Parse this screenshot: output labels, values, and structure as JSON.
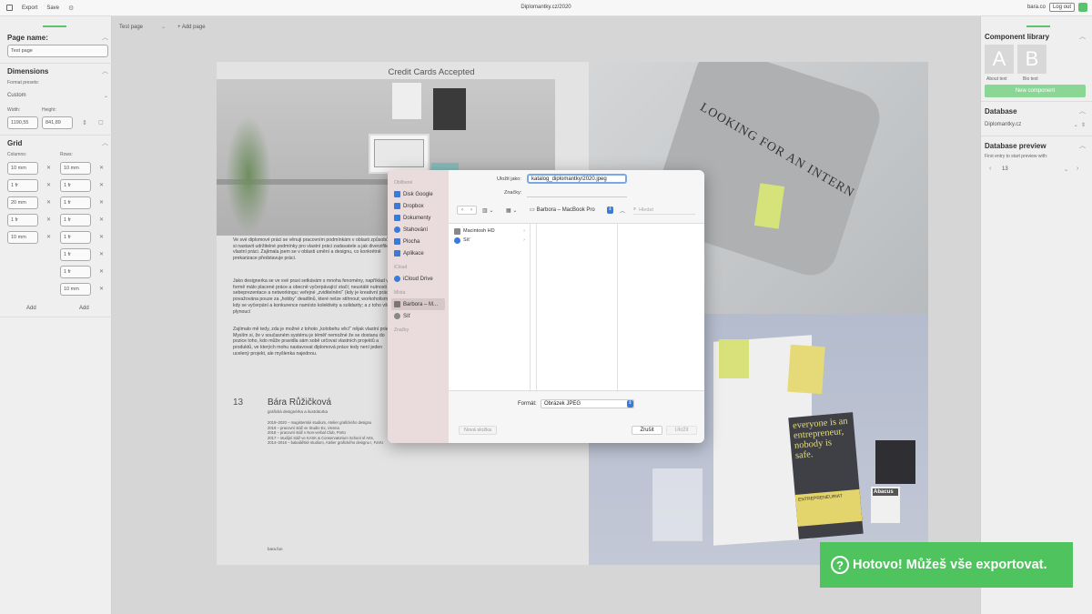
{
  "topbar": {
    "export_label": "Export",
    "save_label": "Save",
    "doc_title": "Diplomantky.cz/2020",
    "user": "bara.co",
    "logout_label": "Log out"
  },
  "left": {
    "page_name_title": "Page name:",
    "page_name_value": "Test page",
    "dimensions_title": "Dimensions",
    "format_presets_label": "Format presets:",
    "format_preset_value": "Custom",
    "width_label": "Width:",
    "height_label": "Height:",
    "width_value": "1190,55",
    "height_value": "841,89",
    "grid_title": "Grid",
    "columns_label": "Columns:",
    "rows_label": "Rows:",
    "columns": [
      "10 mm",
      "1 fr",
      "20 mm",
      "1 fr",
      "10 mm"
    ],
    "rows": [
      "10 mm",
      "1 fr",
      "1 fr",
      "1 fr",
      "1 fr",
      "1 fr",
      "1 fr",
      "10 mm"
    ],
    "add_col_label": "Add",
    "add_row_label": "Add"
  },
  "canvas": {
    "page_select": "Test page",
    "add_page_label": "Add page"
  },
  "page": {
    "photo_title": "Credit Cards Accepted",
    "para1": "Ve své diplomové práci se věnuji pracovním podmínkám v oblasti způsobů, jak si nastavit udržitelné podmínky pro vlastní práci zadavatele a jak diverzifikovat vlastní práci. Zajímala jsem se v oblasti umění a designu, co konkrétně prekarizace představuje práci.",
    "para2": "Jako designerka se ve své praxi setkávám s mnoha fenomény, například ve formě málo placené práce a obecně vyčerpávající stačí; neustálé nutnosti sebeprezentace a networkingu; veřejné „zviditelnění“ (kdy je kreativní práce považována pouze za „hobby“ deadlinů, které nelze stihnout; workoholismu, kdy se vyčerpání a konkurence namísto kolektivity a solidarity; a z toho vše plynoucí",
    "para3": "Zajímalo mě tedy, zda je možné z tohoto „kolobehu věcí“ nějak vlastní práci. Myslím si, že v současném systému je téměř nemožné že se dostanu do pozice toho, kdo může pravidla sám sobě určovat vlastních projektů a produktů, ve kterých mohu nastavovat diplomová práce tedy není jeden ucelený projekt, ale myšlenka najednou.",
    "number": "13",
    "name": "Bára Růžičková",
    "role": "grafická designérka a ilustrátorka",
    "bio": [
      "2019–2020 – magisterské studium, Atelier grafického designu",
      "2019 – pracovní stáž ve Studio Ex, Vienna",
      "2018 – pracovní stáž v Non-verbal Club, Porto",
      "2017 – studijní stáž ve KASK & Conservatorium School of Arts,",
      "2014–2018 – bakalářské studium, Atelier grafického designu I, FaVU"
    ],
    "footer": "bara.fun",
    "shirt_text": "LOOKING FOR AN INTERN",
    "book_text": "everyone is an entrepreneur, nobody is safe.",
    "book_small": "ENTREPRENEURIAT",
    "abacus": "Abacus"
  },
  "dialog": {
    "save_as_label": "Uložit jako:",
    "save_as_value": "katalog_diplomantky/2020.jpeg",
    "tags_label": "Značky:",
    "location": "Barbora – MacBook Pro",
    "search_placeholder": "Hledat",
    "sidebar": {
      "favorites_head": "Oblíbené",
      "favorites": [
        "Disk Google",
        "Dropbox",
        "Dokumenty",
        "Stahování",
        "Plocha",
        "Aplikace"
      ],
      "icloud_head": "iCloud",
      "icloud": [
        "iCloud Drive"
      ],
      "places_head": "Místa",
      "places": [
        "Barbora – M...",
        "Síť"
      ],
      "tags_head": "Značky"
    },
    "column1": [
      "Macintosh HD",
      "Síť"
    ],
    "format_label": "Formát:",
    "format_value": "Obrázek JPEG",
    "new_folder_label": "Nová složka",
    "cancel_label": "Zrušit",
    "save_label": "Uložit"
  },
  "right": {
    "component_library_title": "Component library",
    "comp_a_letter": "A",
    "comp_a_label": "About text",
    "comp_b_letter": "B",
    "comp_b_label": "Bio text",
    "new_component_label": "New component",
    "database_title": "Database",
    "database_value": "Diplomantky.cz",
    "database_preview_title": "Database preview",
    "preview_hint": "First entry to start preview with:",
    "preview_value": "13"
  },
  "toast": {
    "message": "Hotovo! Můžeš vše exportovat."
  },
  "colors": {
    "accent": "#4fc35d",
    "sidebar_pink": "#eadcdc"
  }
}
